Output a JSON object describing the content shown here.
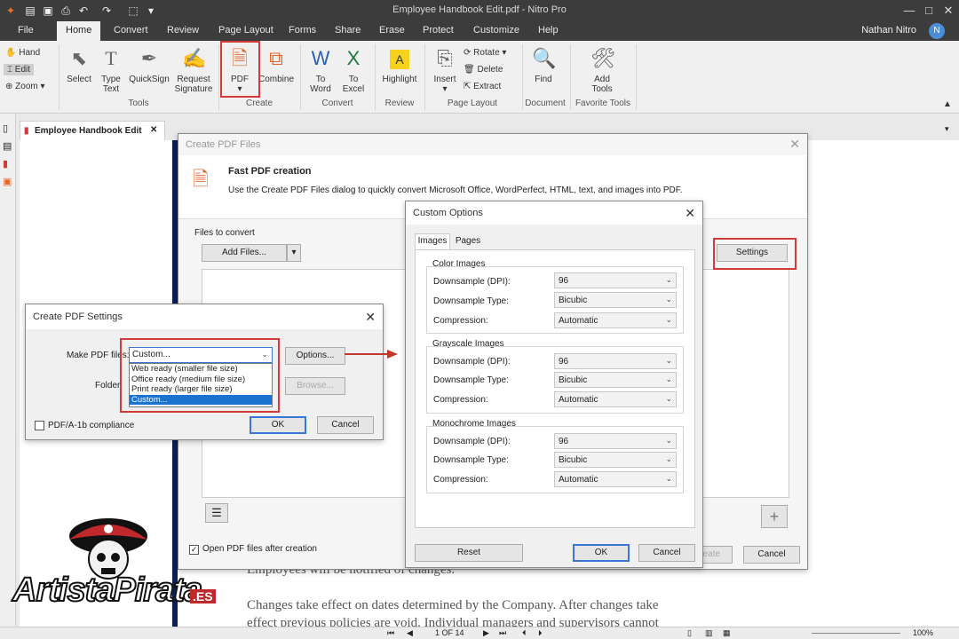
{
  "window": {
    "title": "Employee Handbook Edit.pdf - Nitro Pro",
    "user": "Nathan Nitro",
    "avatar_initial": "N"
  },
  "menu": {
    "tabs": [
      "File",
      "Home",
      "Convert",
      "Review",
      "Page Layout",
      "Forms",
      "Share",
      "Erase",
      "Protect",
      "Customize",
      "Help"
    ]
  },
  "ribbon": {
    "hand": "Hand",
    "edit": "Edit",
    "zoom": "Zoom",
    "select": "Select",
    "type_text": [
      "Type",
      "Text"
    ],
    "quicksign": "QuickSign",
    "request_signature": [
      "Request",
      "Signature"
    ],
    "tools_group": "Tools",
    "pdf": "PDF",
    "combine": "Combine",
    "create_group": "Create",
    "to_word": [
      "To",
      "Word"
    ],
    "to_excel": [
      "To",
      "Excel"
    ],
    "convert_group": "Convert",
    "highlight": "Highlight",
    "review_group": "Review",
    "insert": "Insert",
    "rotate": "Rotate",
    "delete": "Delete",
    "extract": "Extract",
    "page_layout_group": "Page Layout",
    "find": "Find",
    "document_group": "Document",
    "add_tools": [
      "Add",
      "Tools"
    ],
    "favorite_group": "Favorite Tools"
  },
  "document": {
    "tab_title": "Employee Handbook Edit",
    "line1": "Employees will be notified of changes.",
    "line2": "Changes take effect on dates determined by the Company. After changes take",
    "line3": "effect previous policies are void. Individual managers and supervisors cannot"
  },
  "status": {
    "page": "1 OF 14",
    "zoom": "100%"
  },
  "create_pdf_files": {
    "title": "Create PDF Files",
    "heading": "Fast PDF creation",
    "description": "Use the Create PDF Files dialog to quickly convert Microsoft Office, WordPerfect, HTML, text, and images into PDF.",
    "files_label": "Files to convert",
    "add_files": "Add Files...",
    "settings": "Settings",
    "open_after": "Open PDF files after creation",
    "create": "Create",
    "cancel": "Cancel"
  },
  "create_pdf_settings": {
    "title": "Create PDF Settings",
    "make_label": "Make PDF files:",
    "selected": "Custom...",
    "options_list": [
      "Web ready (smaller file size)",
      "Office ready (medium file size)",
      "Print ready (larger file size)",
      "Custom..."
    ],
    "options_button": "Options...",
    "folder_label": "Folder",
    "browse": "Browse...",
    "pdfa": "PDF/A-1b compliance",
    "ok": "OK",
    "cancel": "Cancel"
  },
  "custom_options": {
    "title": "Custom Options",
    "tabs": [
      "Images",
      "Pages"
    ],
    "groups": [
      {
        "name": "Color Images",
        "downsample": "96",
        "type": "Bicubic",
        "compression": "Automatic"
      },
      {
        "name": "Grayscale Images",
        "downsample": "96",
        "type": "Bicubic",
        "compression": "Automatic"
      },
      {
        "name": "Monochrome Images",
        "downsample": "96",
        "type": "Bicubic",
        "compression": "Automatic"
      }
    ],
    "labels": {
      "downsample": "Downsample (DPI):",
      "type": "Downsample Type:",
      "compression": "Compression:"
    },
    "reset": "Reset",
    "ok": "OK",
    "cancel": "Cancel"
  },
  "watermark": {
    "text": "ArtistaPirata",
    "suffix": ".ES"
  },
  "colors": {
    "highlight_red": "#d33a3a",
    "selection_blue": "#1a73d0",
    "titlebar": "#3c3c3c"
  }
}
